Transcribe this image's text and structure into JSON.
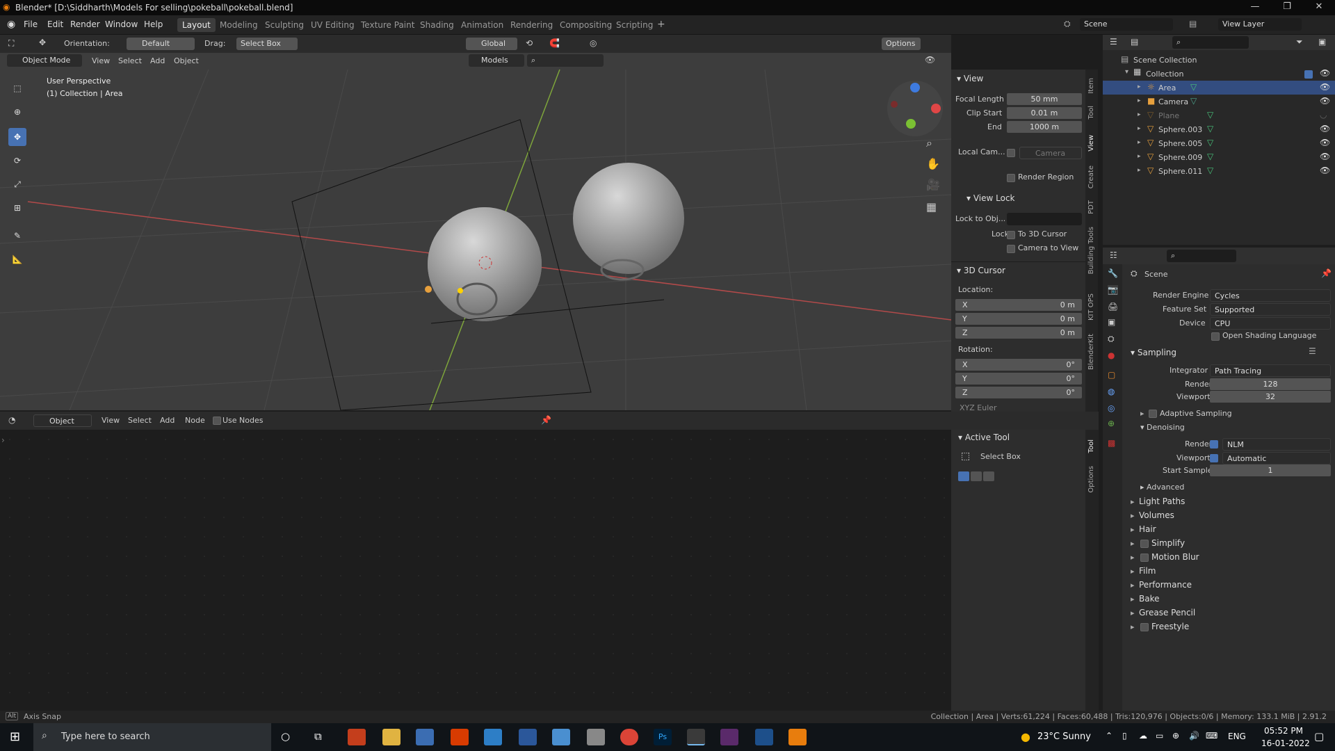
{
  "window": {
    "title": "Blender* [D:\\Siddharth\\Models For selling\\pokeball\\pokeball.blend]"
  },
  "menus": [
    "File",
    "Edit",
    "Render",
    "Window",
    "Help"
  ],
  "workspaces": [
    "Layout",
    "Modeling",
    "Sculpting",
    "UV Editing",
    "Texture Paint",
    "Shading",
    "Animation",
    "Rendering",
    "Compositing",
    "Scripting"
  ],
  "scene": "Scene",
  "view_layer": "View Layer",
  "tool_header": {
    "orientation_label": "Orientation:",
    "orientation": "Default",
    "drag_label": "Drag:",
    "drag": "Select Box",
    "transform": "Global",
    "options": "Options"
  },
  "viewport_header": {
    "mode": "Object Mode",
    "view": "View",
    "select": "Select",
    "add": "Add",
    "object": "Object",
    "models": "Models"
  },
  "viewport": {
    "perspective": "User Perspective",
    "collection": "(1) Collection | Area"
  },
  "n_panel": {
    "view_title": "View",
    "focal_length_label": "Focal Length",
    "focal_length": "50 mm",
    "clip_start_label": "Clip Start",
    "clip_start": "0.01 m",
    "end_label": "End",
    "end": "1000 m",
    "local_cam_label": "Local Cam...",
    "local_cam": "Camera",
    "render_region": "Render Region",
    "view_lock": "View Lock",
    "lock_to_obj": "Lock to Obj...",
    "lock": "Lock",
    "to_3d_cursor": "To 3D Cursor",
    "camera_to_view": "Camera to View",
    "cursor_title": "3D Cursor",
    "location": "Location:",
    "loc": [
      {
        "k": "X",
        "v": "0 m"
      },
      {
        "k": "Y",
        "v": "0 m"
      },
      {
        "k": "Z",
        "v": "0 m"
      }
    ],
    "rotation": "Rotation:",
    "rot": [
      {
        "k": "X",
        "v": "0°"
      },
      {
        "k": "Y",
        "v": "0°"
      },
      {
        "k": "Z",
        "v": "0°"
      }
    ],
    "euler": "XYZ Euler"
  },
  "n_tabs": [
    "Item",
    "Tool",
    "View",
    "Create",
    "PDT",
    "Building Tools",
    "KIT OPS",
    "BlenderKit"
  ],
  "node_header": {
    "object": "Object",
    "view": "View",
    "select": "Select",
    "add": "Add",
    "node": "Node",
    "use_nodes": "Use Nodes"
  },
  "active_tool": {
    "title": "Active Tool",
    "tool": "Select Box"
  },
  "node_tabs": [
    "Tool",
    "Options"
  ],
  "outliner": {
    "root": "Scene Collection",
    "collection": "Collection",
    "items": [
      {
        "name": "Area",
        "type": "light",
        "selected": true
      },
      {
        "name": "Camera",
        "type": "camera"
      },
      {
        "name": "Plane",
        "type": "mesh",
        "dim": true
      },
      {
        "name": "Sphere.003",
        "type": "mesh"
      },
      {
        "name": "Sphere.005",
        "type": "mesh"
      },
      {
        "name": "Sphere.009",
        "type": "mesh"
      },
      {
        "name": "Sphere.011",
        "type": "mesh"
      }
    ]
  },
  "properties": {
    "scene": "Scene",
    "render_engine_label": "Render Engine",
    "render_engine": "Cycles",
    "feature_set_label": "Feature Set",
    "feature_set": "Supported",
    "device_label": "Device",
    "device": "CPU",
    "osl": "Open Shading Language",
    "sampling": "Sampling",
    "integrator_label": "Integrator",
    "integrator": "Path Tracing",
    "render_label": "Render",
    "render": "128",
    "viewport_label": "Viewport",
    "viewport": "32",
    "adaptive": "Adaptive Sampling",
    "denoising": "Denoising",
    "d_render_label": "Render",
    "d_render": "NLM",
    "d_viewport_label": "Viewport",
    "d_viewport": "Automatic",
    "start_sample_label": "Start Sample",
    "start_sample": "1",
    "advanced": "Advanced",
    "sections": [
      "Light Paths",
      "Volumes",
      "Hair",
      "Simplify",
      "Motion Blur",
      "Film",
      "Performance",
      "Bake",
      "Grease Pencil",
      "Freestyle"
    ]
  },
  "status": {
    "left_key": "Alt",
    "left": "Axis Snap",
    "right": "Collection | Area | Verts:61,224 | Faces:60,488 | Tris:120,976 | Objects:0/6 | Memory: 133.1 MiB | 2.91.2"
  },
  "taskbar": {
    "search": "Type here to search",
    "weather": "23°C  Sunny",
    "lang": "ENG",
    "time": "05:52 PM",
    "date": "16-01-2022"
  }
}
